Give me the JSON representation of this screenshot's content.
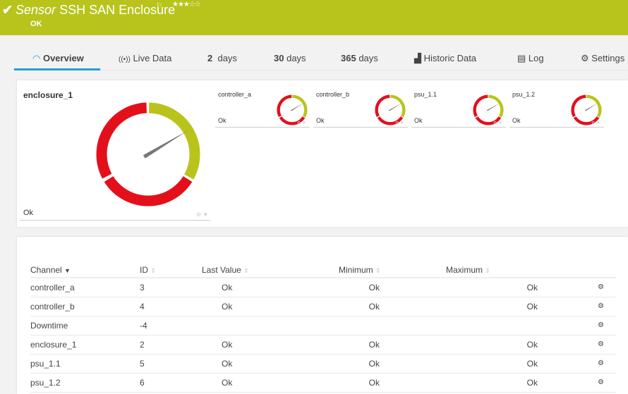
{
  "header": {
    "check_icon": "✔",
    "prefix": "Sensor",
    "name": "SSH SAN Enclosure",
    "flag_icon": "⚐",
    "stars": "★★★☆☆",
    "status": "OK",
    "color": "#b8c41c"
  },
  "tabs": [
    {
      "label": "Overview",
      "icon": "gauge-icon"
    },
    {
      "label": "Live Data",
      "icon": "broadcast-icon"
    },
    {
      "num": "2",
      "label": "days"
    },
    {
      "num": "30",
      "label": "days"
    },
    {
      "num": "365",
      "label": "days"
    },
    {
      "label": "Historic Data",
      "icon": "chart-icon"
    },
    {
      "label": "Log",
      "icon": "log-icon"
    },
    {
      "label": "Settings",
      "icon": "gear-icon"
    }
  ],
  "gauges": {
    "main": {
      "name": "enclosure_1",
      "value": "Ok"
    },
    "small": [
      {
        "name": "controller_a",
        "value": "Ok"
      },
      {
        "name": "controller_b",
        "value": "Ok"
      },
      {
        "name": "psu_1.1",
        "value": "Ok"
      },
      {
        "name": "psu_1.2",
        "value": "Ok"
      }
    ],
    "colors": {
      "ok": "#b8c41c",
      "error": "#e3101c",
      "needle": "#777777"
    }
  },
  "table": {
    "headers": [
      "Channel",
      "ID",
      "Last Value",
      "Minimum",
      "Maximum"
    ],
    "rows": [
      [
        "controller_a",
        "3",
        "Ok",
        "Ok",
        "Ok"
      ],
      [
        "controller_b",
        "4",
        "Ok",
        "Ok",
        "Ok"
      ],
      [
        "Downtime",
        "-4",
        "",
        "",
        ""
      ],
      [
        "enclosure_1",
        "2",
        "Ok",
        "Ok",
        "Ok"
      ],
      [
        "psu_1.1",
        "5",
        "Ok",
        "Ok",
        "Ok"
      ],
      [
        "psu_1.2",
        "6",
        "Ok",
        "Ok",
        "Ok"
      ]
    ]
  }
}
